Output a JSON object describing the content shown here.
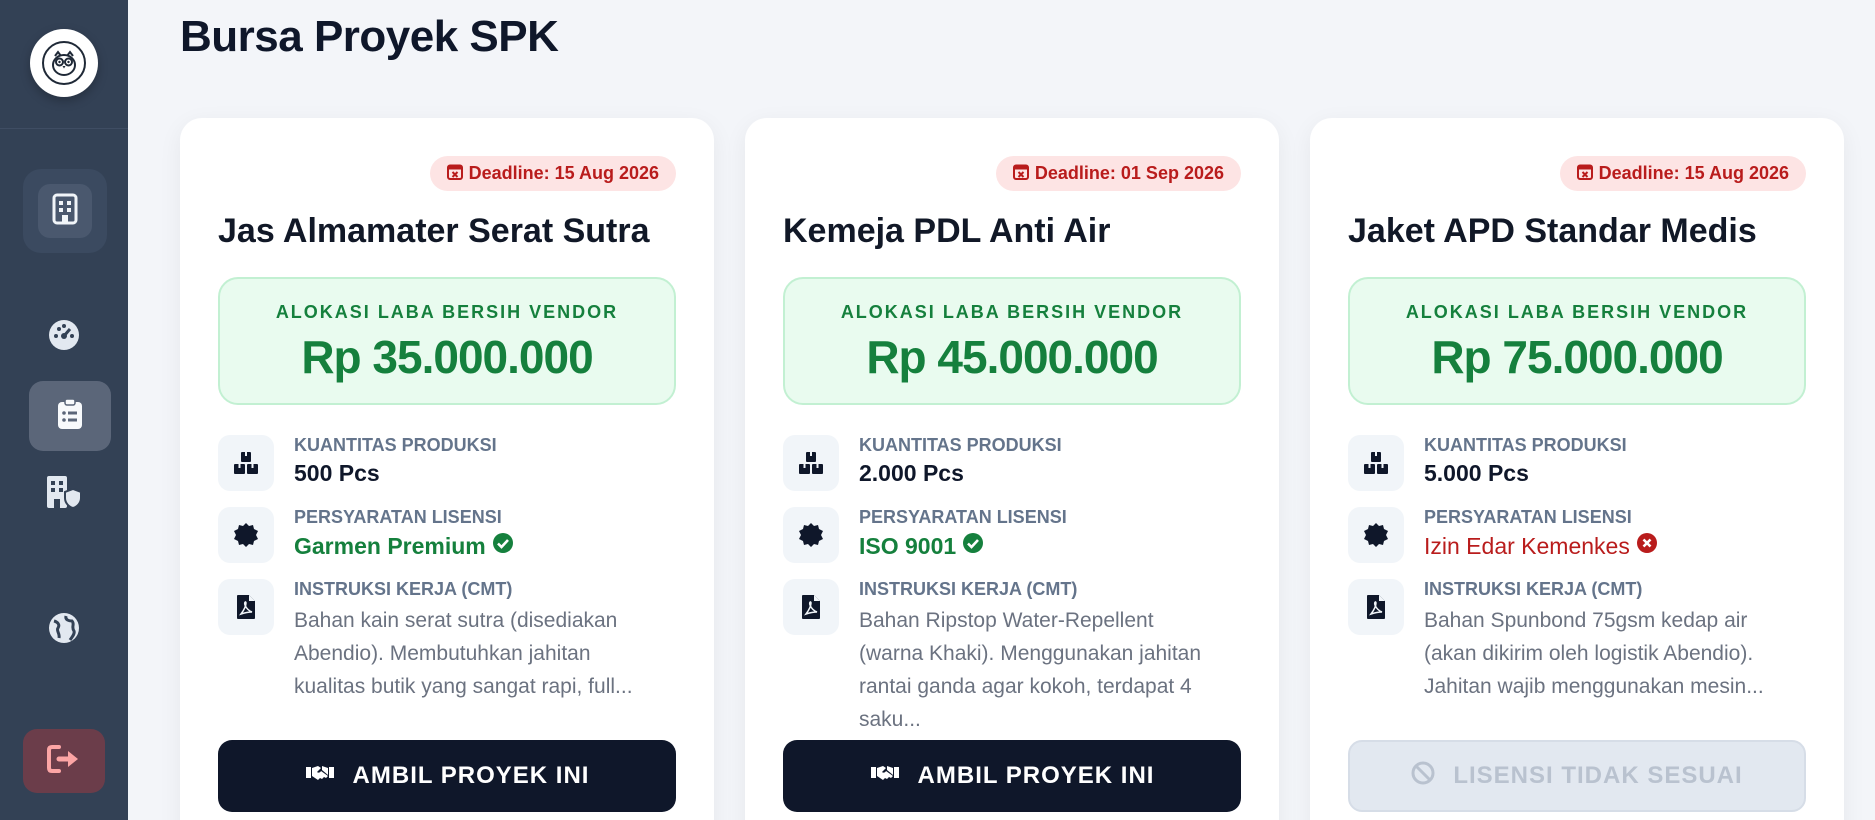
{
  "page_title": "Bursa Proyek SPK",
  "sidebar": {
    "items": [
      {
        "name": "building",
        "icon": "building-icon"
      },
      {
        "name": "dashboard",
        "icon": "gauge-icon"
      },
      {
        "name": "projects",
        "icon": "clipboard-icon"
      },
      {
        "name": "company",
        "icon": "building-shield-icon"
      },
      {
        "name": "global",
        "icon": "globe-icon"
      },
      {
        "name": "logout",
        "icon": "logout-icon"
      }
    ]
  },
  "cards": [
    {
      "deadline": "Deadline: 15 Aug 2026",
      "title": "Jas Almamater Serat Sutra",
      "profit_label": "ALOKASI LABA BERSIH VENDOR",
      "profit_value": "Rp 35.000.000",
      "qty_label": "KUANTITAS PRODUKSI",
      "qty_value": "500 Pcs",
      "license_label": "PERSYARATAN LISENSI",
      "license_value": "Garmen Premium",
      "license_status": "ok",
      "cmt_label": "INSTRUKSI KERJA (CMT)",
      "cmt_value": "Bahan kain serat sutra (disediakan Abendio). Membutuhkan jahitan kualitas butik yang sangat rapi, full...",
      "button_label": "AMBIL PROYEK INI",
      "button_enabled": true
    },
    {
      "deadline": "Deadline: 01 Sep 2026",
      "title": "Kemeja PDL Anti Air",
      "profit_label": "ALOKASI LABA BERSIH VENDOR",
      "profit_value": "Rp 45.000.000",
      "qty_label": "KUANTITAS PRODUKSI",
      "qty_value": "2.000 Pcs",
      "license_label": "PERSYARATAN LISENSI",
      "license_value": "ISO 9001",
      "license_status": "ok",
      "cmt_label": "INSTRUKSI KERJA (CMT)",
      "cmt_value": "Bahan Ripstop Water-Repellent (warna Khaki). Menggunakan jahitan rantai ganda agar kokoh, terdapat 4 saku...",
      "button_label": "AMBIL PROYEK INI",
      "button_enabled": true
    },
    {
      "deadline": "Deadline: 15 Aug 2026",
      "title": "Jaket APD Standar Medis",
      "profit_label": "ALOKASI LABA BERSIH VENDOR",
      "profit_value": "Rp 75.000.000",
      "qty_label": "KUANTITAS PRODUKSI",
      "qty_value": "5.000 Pcs",
      "license_label": "PERSYARATAN LISENSI",
      "license_value": "Izin Edar Kemenkes",
      "license_status": "fail",
      "cmt_label": "INSTRUKSI KERJA (CMT)",
      "cmt_value": "Bahan Spunbond 75gsm kedap air (akan dikirim oleh logistik Abendio). Jahitan wajib menggunakan mesin...",
      "button_label": "LISENSI TIDAK SESUAI",
      "button_enabled": false
    }
  ],
  "colors": {
    "sidebar": "#334155",
    "accent_green": "#15803d",
    "danger_red": "#b91c1c",
    "button_dark": "#0f172a"
  }
}
